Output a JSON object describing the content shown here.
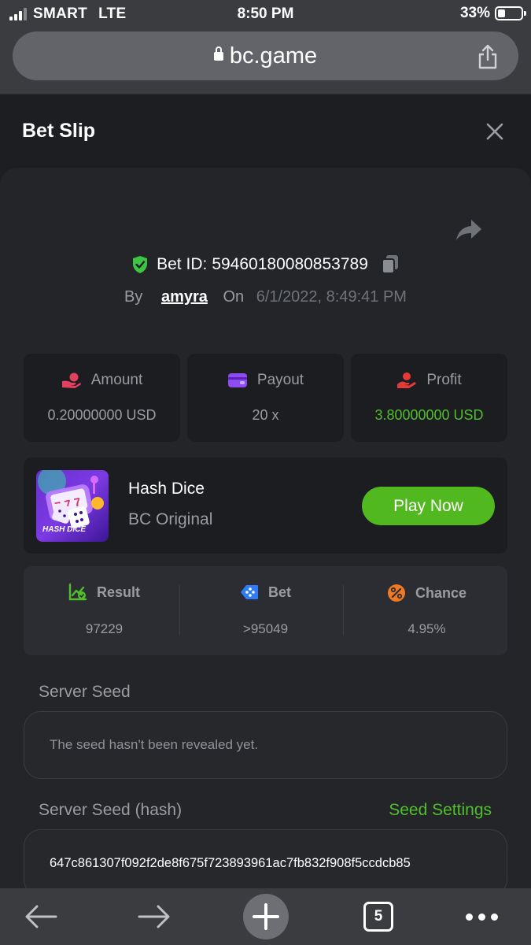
{
  "status_bar": {
    "carrier": "SMART",
    "network": "LTE",
    "time": "8:50 PM",
    "battery": "33%",
    "battery_level": 0.33
  },
  "browser": {
    "url": "bc.game",
    "tab_count": "5"
  },
  "sheet": {
    "title": "Bet Slip"
  },
  "bet": {
    "id_label": "Bet ID:",
    "id": "59460180080853789",
    "by_label": "By",
    "user": "amyra",
    "on_label": "On",
    "date": "6/1/2022, 8:49:41 PM"
  },
  "stats": [
    {
      "label": "Amount",
      "value": "0.20000000 USD",
      "icon": "coins-hand-icon",
      "color": "#e2405f"
    },
    {
      "label": "Payout",
      "value": "20 x",
      "icon": "wallet-icon",
      "color": "#8d4bf0"
    },
    {
      "label": "Profit",
      "value": "3.80000000 USD",
      "icon": "profit-hand-icon",
      "color": "#e33a3a"
    }
  ],
  "game": {
    "name": "Hash Dice",
    "provider": "BC Original",
    "play_label": "Play Now",
    "thumb_text": "HASH DICE"
  },
  "result": [
    {
      "label": "Result",
      "value": "97229",
      "icon": "chart-check-icon",
      "color": "#4fbf2b"
    },
    {
      "label": "Bet",
      "value": ">95049",
      "icon": "dice-tag-icon",
      "color": "#2f7cf6"
    },
    {
      "label": "Chance",
      "value": "4.95%",
      "icon": "percent-icon",
      "color": "#f07a23"
    }
  ],
  "seeds": {
    "server_seed_label": "Server Seed",
    "server_seed_value": "The seed hasn't been revealed yet.",
    "server_hash_label": "Server Seed (hash)",
    "seed_settings_label": "Seed Settings",
    "server_hash_value": "647c861307f092f2de8f675f723893961ac7fb832f908f5ccdcb85"
  },
  "colors": {
    "accent_green": "#52b81f",
    "background": "#1c1e22",
    "card": "#232529"
  }
}
